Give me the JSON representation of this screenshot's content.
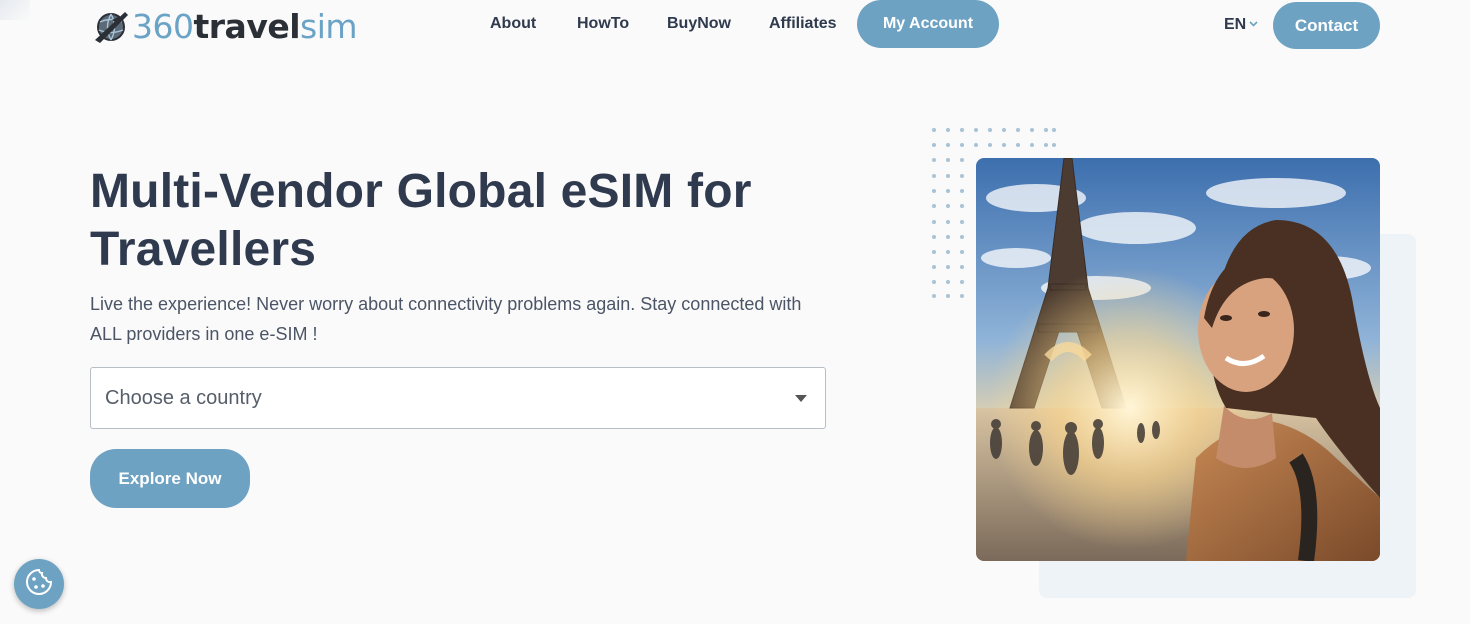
{
  "logo": {
    "part1": "360",
    "part2": "travel",
    "part3": "sim"
  },
  "nav": {
    "items": [
      {
        "label": "About"
      },
      {
        "label": "HowTo"
      },
      {
        "label": "BuyNow"
      },
      {
        "label": "Affiliates"
      }
    ],
    "account_label": "My Account",
    "language": "EN",
    "contact_label": "Contact"
  },
  "hero": {
    "title": "Multi-Vendor Global eSIM for Travellers",
    "subtitle": "Live the experience! Never worry about connectivity problems again. Stay connected with ALL providers in one e-SIM !",
    "country_placeholder": "Choose a country",
    "cta_label": "Explore Now"
  },
  "icons": {
    "logo": "globe-plane-icon",
    "language_chevron": "chevron-down-icon",
    "select_caret": "caret-down-icon",
    "cookie": "cookie-icon"
  },
  "colors": {
    "accent": "#6ea2c3",
    "text": "#2f3a4e",
    "background": "#fafafa"
  }
}
